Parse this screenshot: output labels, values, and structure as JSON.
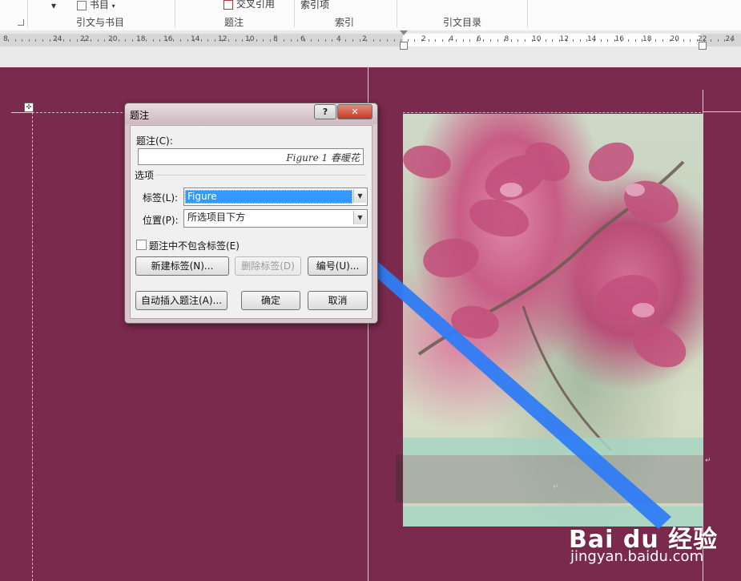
{
  "ribbon": {
    "toc_arrow": "▾",
    "bibliography_label": "书目",
    "cross_reference_label": "交叉引用",
    "mark_entry_label": "索引项",
    "groups": [
      "引文与书目",
      "题注",
      "索引",
      "引文目录"
    ]
  },
  "ruler": {
    "left_numbers": [
      "8",
      "24",
      "22",
      "20",
      "18",
      "16",
      "14",
      "12",
      "10",
      "8",
      "6",
      "4",
      "2"
    ],
    "right_numbers": [
      "2",
      "4",
      "6",
      "8",
      "10",
      "12",
      "14",
      "16",
      "18",
      "20",
      "22",
      "24"
    ]
  },
  "dialog": {
    "title": "题注",
    "help_label": "?",
    "close_label": "✕",
    "caption_label": "题注(C):",
    "caption_value": "Figure 1 春暖花",
    "options_label": "选项",
    "label_label": "标签(L):",
    "label_value": "Figure",
    "position_label": "位置(P):",
    "position_value": "所选项目下方",
    "exclude_label_text": "题注中不包含标签(E)",
    "exclude_label_checked": false,
    "new_label_button": "新建标签(N)...",
    "delete_label_button": "删除标签(D)",
    "numbering_button": "编号(U)...",
    "autocaption_button": "自动插入题注(A)...",
    "ok_button": "确定",
    "cancel_button": "取消"
  },
  "document": {
    "paragraph_mark": "↵",
    "move_handle": "✣"
  },
  "watermark": {
    "brand": "Bai du 经验",
    "url": "jingyan.baidu.com"
  },
  "colors": {
    "page_background": "#7a2a4c",
    "arrow": "#2f7cf6",
    "selection": "#3399ff"
  }
}
